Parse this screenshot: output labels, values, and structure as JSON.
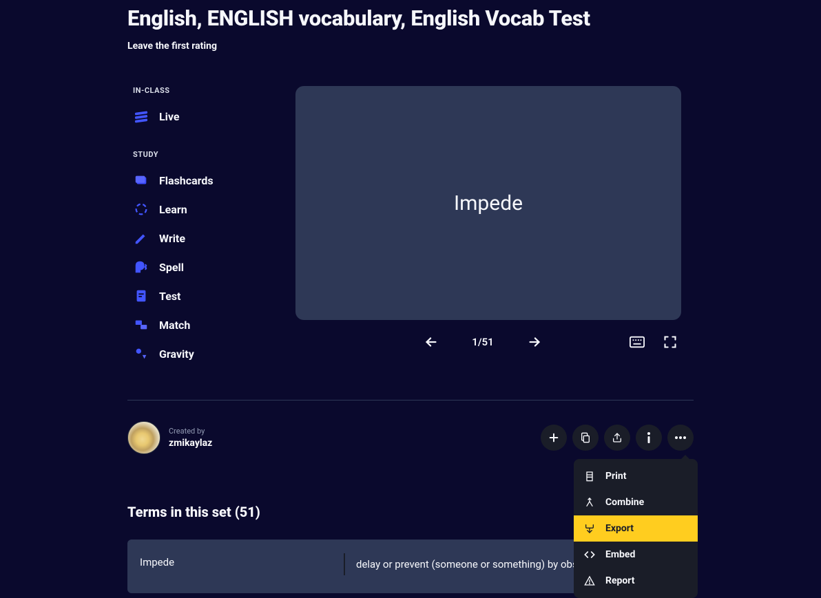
{
  "title": "English, ENGLISH vocabulary, English Vocab Test",
  "rating_prompt": "Leave the first rating",
  "sidebar": {
    "section1_label": "IN-CLASS",
    "section2_label": "STUDY",
    "live": "Live",
    "flashcards": "Flashcards",
    "learn": "Learn",
    "write": "Write",
    "spell": "Spell",
    "test": "Test",
    "match": "Match",
    "gravity": "Gravity"
  },
  "card": {
    "word": "Impede",
    "counter": "1/51"
  },
  "author": {
    "created_by": "Created by",
    "name": "zmikaylaz"
  },
  "dropdown": {
    "print": "Print",
    "combine": "Combine",
    "export": "Export",
    "embed": "Embed",
    "report": "Report"
  },
  "terms": {
    "header": "Terms in this set (51)",
    "first_word": "Impede",
    "first_def": "delay or prevent (someone or something) by obstructing them; hinder."
  }
}
